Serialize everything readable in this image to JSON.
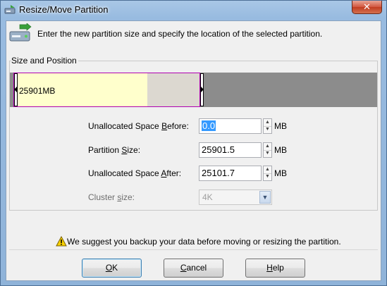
{
  "window": {
    "title": "Resize/Move Partition",
    "close_label": "✕"
  },
  "header": {
    "instruction": "Enter the new partition size and specify the location of the selected partition."
  },
  "group": {
    "legend": "Size and Position",
    "partition_label": "25901MB",
    "used_fraction": 0.71
  },
  "fields": {
    "before": {
      "label_pre": "Unallocated Space ",
      "label_key": "B",
      "label_post": "efore:",
      "value": "0.0",
      "unit": "MB"
    },
    "size": {
      "label_pre": "Partition ",
      "label_key": "S",
      "label_post": "ize:",
      "value": "25901.5",
      "unit": "MB"
    },
    "after": {
      "label_pre": "Unallocated Space ",
      "label_key": "A",
      "label_post": "fter:",
      "value": "25101.7",
      "unit": "MB"
    },
    "cluster": {
      "label_pre": "Cluster ",
      "label_key": "s",
      "label_post": "ize:",
      "value": "4K"
    }
  },
  "warning": "We suggest you backup your data before moving or resizing the partition.",
  "buttons": {
    "ok": {
      "key": "O",
      "rest": "K"
    },
    "cancel": {
      "key": "C",
      "rest": "ancel"
    },
    "help": {
      "key": "H",
      "rest": "elp"
    }
  },
  "colors": {
    "used": "#ffffcc",
    "partition_border": "#b000b0",
    "unallocated": "#8c8c8c",
    "selection": "#3399ff"
  }
}
